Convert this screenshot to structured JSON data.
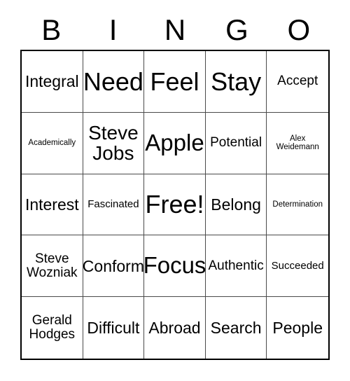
{
  "header": {
    "letters": [
      "B",
      "I",
      "N",
      "G",
      "O"
    ]
  },
  "grid": {
    "rows": [
      [
        {
          "text": "Integral",
          "size": "s-md"
        },
        {
          "text": "Need",
          "size": "s-xxl"
        },
        {
          "text": "Feel",
          "size": "s-xxl"
        },
        {
          "text": "Stay",
          "size": "s-xxl"
        },
        {
          "text": "Accept",
          "size": "s-sm"
        }
      ],
      [
        {
          "text": "Academically",
          "size": "s-xxs"
        },
        {
          "text": "Steve\nJobs",
          "size": "s-lg"
        },
        {
          "text": "Apple",
          "size": "s-xl"
        },
        {
          "text": "Potential",
          "size": "s-sm"
        },
        {
          "text": "Alex\nWeidemann",
          "size": "s-xxs"
        }
      ],
      [
        {
          "text": "Interest",
          "size": "s-md"
        },
        {
          "text": "Fascinated",
          "size": "s-xs"
        },
        {
          "text": "Free!",
          "size": "s-xxl"
        },
        {
          "text": "Belong",
          "size": "s-md"
        },
        {
          "text": "Determination",
          "size": "s-xxs"
        }
      ],
      [
        {
          "text": "Steve\nWozniak",
          "size": "s-sm"
        },
        {
          "text": "Conform",
          "size": "s-md"
        },
        {
          "text": "Focus",
          "size": "s-xl"
        },
        {
          "text": "Authentic",
          "size": "s-sm"
        },
        {
          "text": "Succeeded",
          "size": "s-xs"
        }
      ],
      [
        {
          "text": "Gerald\nHodges",
          "size": "s-sm"
        },
        {
          "text": "Difficult",
          "size": "s-md"
        },
        {
          "text": "Abroad",
          "size": "s-md"
        },
        {
          "text": "Search",
          "size": "s-md"
        },
        {
          "text": "People",
          "size": "s-md"
        }
      ]
    ]
  },
  "colors": {
    "background": "#ffffff",
    "text": "#000000",
    "outer_border": "#000000",
    "inner_border": "#4a4a4a"
  }
}
